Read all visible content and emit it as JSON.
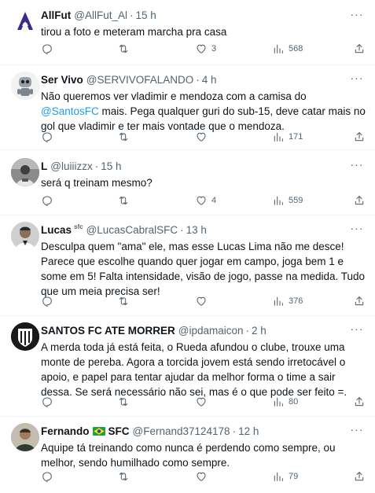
{
  "tweets": [
    {
      "name": "AllFut",
      "handle": "@AllFut_Al",
      "time": "15 h",
      "text_lines": [
        "tirou a foto e meteram marcha pra casa"
      ],
      "replies": "",
      "retweets": "",
      "likes": "3",
      "views": "568"
    },
    {
      "name": "Ser Vivo",
      "handle": "@SERVIVOFALANDO",
      "time": "4 h",
      "text_before_mention": "Não queremos ver vladimir e mendoza com a camisa do ",
      "mention": "@SantosFC",
      "text_after_mention": " mais. Pega qualquer guri do sub-15, deve catar mais no gol que vladimir e ter mais vontade que o mendoza.",
      "replies": "",
      "retweets": "",
      "likes": "",
      "views": "171"
    },
    {
      "name": "L",
      "handle": "@luiiizzx",
      "time": "15 h",
      "text_lines": [
        "será q treinam mesmo?"
      ],
      "replies": "",
      "retweets": "",
      "likes": "4",
      "views": "559"
    },
    {
      "name": "Lucas",
      "name_tag": "sfc",
      "handle": "@LucasCabralSFC",
      "time": "13 h",
      "text": "Desculpa quem \"ama\" ele, mas esse Lucas Lima não me desce! Parece que escolhe quando quer jogar em campo, joga bem 1 e some em 5! Falta intensidade, visão de jogo, passe na medida. Tudo que um meia precisa ser!",
      "replies": "",
      "retweets": "",
      "likes": "",
      "views": "376"
    },
    {
      "name": "SANTOS FC ATE MORRER",
      "handle": "@ipdamaicon",
      "time": "2 h",
      "text": "A merda toda já está feita, o Rueda afundou o clube, trouxe uma monte de pereba. Agora a torcida jovem está sendo irretocável o apoio, e papel para tentar ajudar da melhor forma o time a sair dessa. Se será necessário não sei, mas é o que pode ser feito =.",
      "replies": "",
      "retweets": "",
      "likes": "",
      "views": "80"
    },
    {
      "name": "Fernando",
      "name_suffix": "SFC",
      "handle": "@Fernand37124178",
      "time": "12 h",
      "text": "Aquipe tá treinando como nunca é perdendo como sempre, ou melhor, sendo humilhado como sempre.",
      "replies": "",
      "retweets": "",
      "likes": "",
      "views": "79"
    }
  ],
  "separator": "·",
  "more_glyph": "···",
  "icons": {
    "reply": "reply-icon",
    "retweet": "retweet-icon",
    "like": "heart-icon",
    "views": "views-icon",
    "share": "share-icon",
    "more": "more-icon"
  },
  "colors": {
    "text": "#0f1419",
    "secondary": "#536471",
    "link": "#1d9bf0",
    "border": "#eff3f4"
  }
}
